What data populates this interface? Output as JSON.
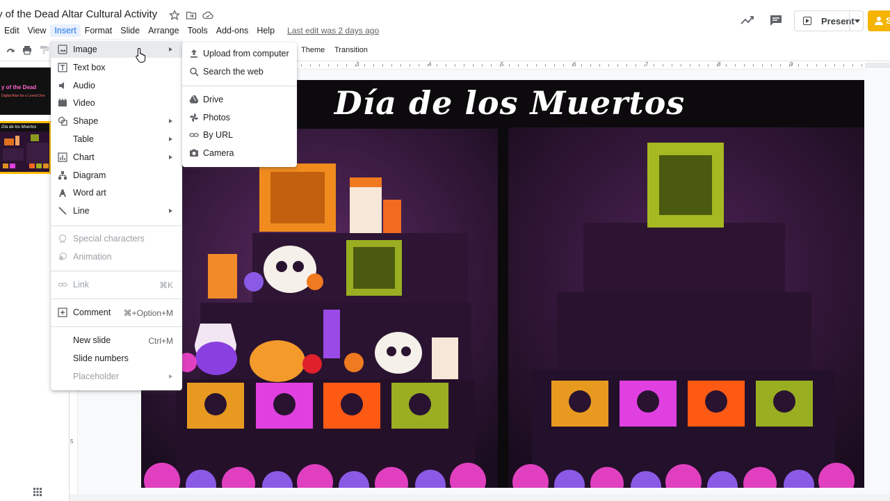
{
  "doc": {
    "title": "y of the Dead Altar Cultural Activity",
    "last_edit": "Last edit was 2 days ago"
  },
  "menubar": [
    {
      "label": "Edit"
    },
    {
      "label": "View"
    },
    {
      "label": "Insert"
    },
    {
      "label": "Format"
    },
    {
      "label": "Slide"
    },
    {
      "label": "Arrange"
    },
    {
      "label": "Tools"
    },
    {
      "label": "Add-ons"
    },
    {
      "label": "Help"
    }
  ],
  "header": {
    "present_label": "Present",
    "share_label": "S"
  },
  "toolbar": {
    "theme_label": "Theme",
    "transition_label": "Transition"
  },
  "ruler": [
    "3",
    "4",
    "5",
    "6",
    "7",
    "8",
    "9"
  ],
  "vruler_label": "5",
  "filmstrip": {
    "thumb1_title": "y of the Dead",
    "thumb1_sub": "Digital Altar for a Loved One",
    "thumb2_title": "Día de los Muertos"
  },
  "slide": {
    "heading": "Día de los Muertos"
  },
  "insert_menu": {
    "image": "Image",
    "text_box": "Text box",
    "audio": "Audio",
    "video": "Video",
    "shape": "Shape",
    "table": "Table",
    "chart": "Chart",
    "diagram": "Diagram",
    "word_art": "Word art",
    "line": "Line",
    "special_characters": "Special characters",
    "animation": "Animation",
    "link": "Link",
    "link_shortcut": "⌘K",
    "comment": "Comment",
    "comment_shortcut": "⌘+Option+M",
    "new_slide": "New slide",
    "new_slide_shortcut": "Ctrl+M",
    "slide_numbers": "Slide numbers",
    "placeholder": "Placeholder"
  },
  "image_submenu": {
    "upload": "Upload from computer",
    "search": "Search the web",
    "drive": "Drive",
    "photos": "Photos",
    "by_url": "By URL",
    "camera": "Camera"
  },
  "colors": {
    "accent": "#1a73e8",
    "share": "#f4b400",
    "slide_bg": "#120a14"
  }
}
